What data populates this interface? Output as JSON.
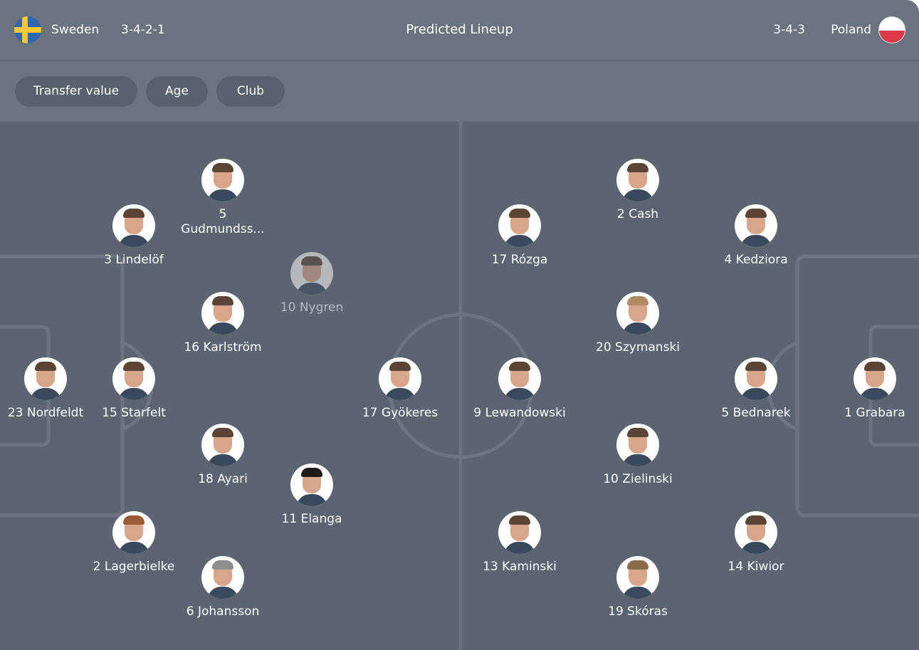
{
  "header": {
    "title": "Predicted Lineup",
    "home": {
      "team": "Sweden",
      "formation": "3-4-2-1",
      "flag_icon": "sweden-flag-icon"
    },
    "away": {
      "team": "Poland",
      "formation": "3-4-3",
      "flag_icon": "poland-flag-icon"
    }
  },
  "filters": [
    "Transfer value",
    "Age",
    "Club"
  ],
  "home_players": [
    {
      "number": "5",
      "name": "Gudmundss..."
    },
    {
      "number": "3",
      "name": "Lindelöf"
    },
    {
      "number": "10",
      "name": "Nygren",
      "substitute_style": true
    },
    {
      "number": "16",
      "name": "Karlström"
    },
    {
      "number": "23",
      "name": "Nordfeldt"
    },
    {
      "number": "15",
      "name": "Starfelt"
    },
    {
      "number": "17",
      "name": "Gyökeres"
    },
    {
      "number": "18",
      "name": "Ayari"
    },
    {
      "number": "11",
      "name": "Elanga"
    },
    {
      "number": "2",
      "name": "Lagerbielke"
    },
    {
      "number": "6",
      "name": "Johansson"
    }
  ],
  "away_players": [
    {
      "number": "2",
      "name": "Cash"
    },
    {
      "number": "17",
      "name": "Rózga"
    },
    {
      "number": "4",
      "name": "Kedziora"
    },
    {
      "number": "20",
      "name": "Szymanski"
    },
    {
      "number": "9",
      "name": "Lewandowski"
    },
    {
      "number": "5",
      "name": "Bednarek"
    },
    {
      "number": "1",
      "name": "Grabara"
    },
    {
      "number": "10",
      "name": "Zielinski"
    },
    {
      "number": "13",
      "name": "Kaminski"
    },
    {
      "number": "14",
      "name": "Kiwior"
    },
    {
      "number": "19",
      "name": "Skóras"
    }
  ],
  "colors": {
    "header_bg": "#6a737e",
    "pitch_bg": "#5b6470",
    "pitch_lines": "#6b7480",
    "pill_bg": "#59616c"
  }
}
